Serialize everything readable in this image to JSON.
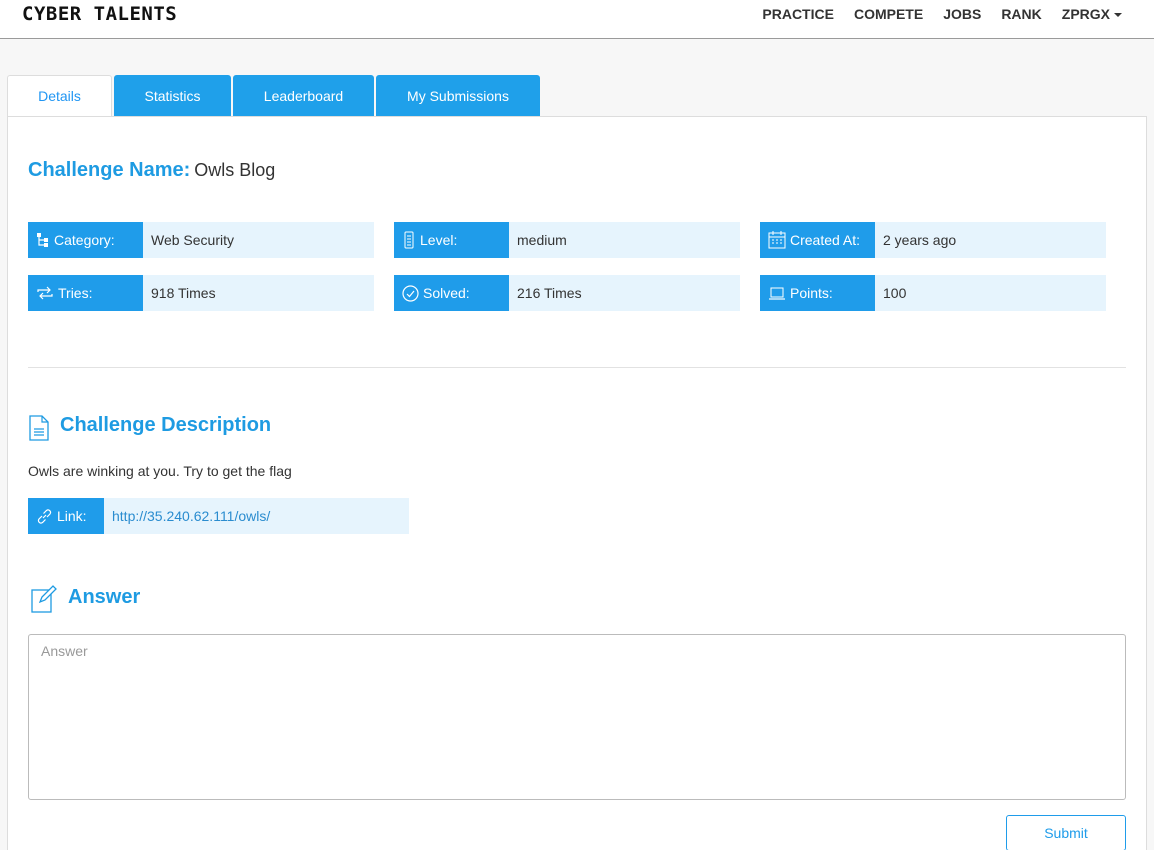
{
  "header": {
    "logo": "CYBER TALENTS",
    "nav": [
      "PRACTICE",
      "COMPETE",
      "JOBS",
      "RANK"
    ],
    "user": "ZPRGX"
  },
  "tabs": [
    "Details",
    "Statistics",
    "Leaderboard",
    "My Submissions"
  ],
  "challenge": {
    "name_label": "Challenge Name:",
    "name": "Owls Blog"
  },
  "info": {
    "category_label": "Category:",
    "category": "Web Security",
    "level_label": "Level:",
    "level": "medium",
    "created_label": "Created At:",
    "created": "2 years ago",
    "tries_label": "Tries:",
    "tries": "918 Times",
    "solved_label": "Solved:",
    "solved": "216 Times",
    "points_label": "Points:",
    "points": "100"
  },
  "description": {
    "title": "Challenge Description",
    "text": "Owls are winking at you. Try to get the flag",
    "link_label": "Link:",
    "link": "http://35.240.62.111/owls/"
  },
  "answer": {
    "title": "Answer",
    "placeholder": "Answer",
    "submit_label": "Submit"
  },
  "colors": {
    "accent": "#1f9cea",
    "light": "#e6f4fd"
  },
  "icons": [
    "sitemap-icon",
    "level-icon",
    "calendar-icon",
    "repeat-icon",
    "check-circle-icon",
    "laptop-icon",
    "link-icon",
    "document-icon",
    "edit-icon"
  ]
}
